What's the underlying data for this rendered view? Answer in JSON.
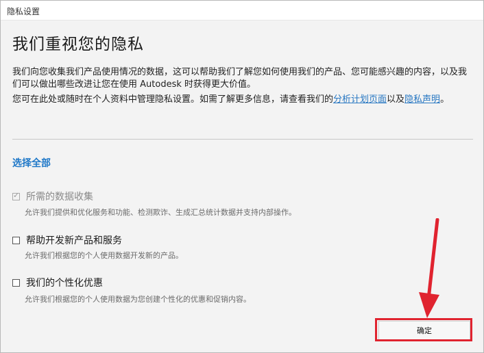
{
  "window": {
    "title": "隐私设置"
  },
  "heading": "我们重视您的隐私",
  "paragraph1": "我们向您收集我们产品使用情况的数据，这可以帮助我们了解您如何使用我们的产品、您可能感兴趣的内容，以及我们可以做出哪些改进让您在使用 Autodesk 时获得更大价值。",
  "paragraph2": {
    "text": "您可在此处或随时在个人资料中管理隐私设置。如需了解更多信息，请查看我们的",
    "link1": "分析计划页面",
    "mid": "以及",
    "link2": "隐私声明",
    "end": "。"
  },
  "select_all": "选择全部",
  "options": [
    {
      "label": "所需的数据收集",
      "description": "允许我们提供和优化服务和功能、检测欺诈、生成汇总统计数据并支持内部操作。",
      "checked": true,
      "disabled": true
    },
    {
      "label": "帮助开发新产品和服务",
      "description": "允许我们根据您的个人使用数据开发新的产品。",
      "checked": false,
      "disabled": false
    },
    {
      "label": "我们的个性化优惠",
      "description": "允许我们根据您的个人使用数据为您创建个性化的优惠和促销内容。",
      "checked": false,
      "disabled": false
    }
  ],
  "ok_button": "确定",
  "colors": {
    "link": "#2777c2",
    "accent_red": "#e0232f",
    "select_all": "#1f78c8"
  }
}
